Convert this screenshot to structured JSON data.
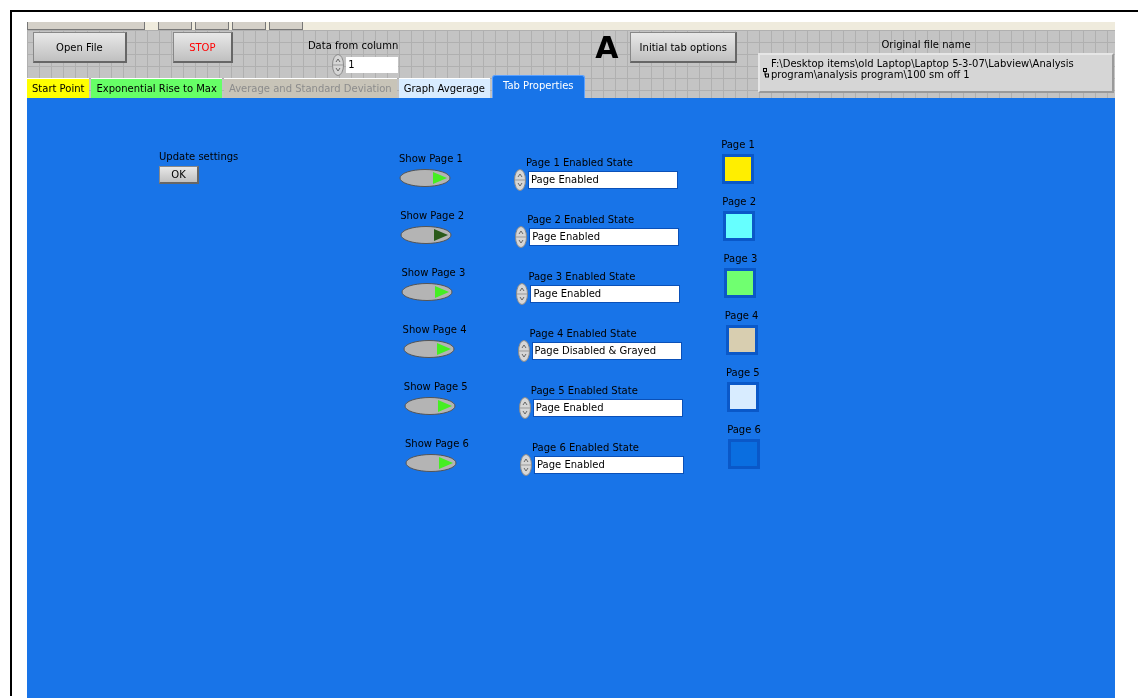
{
  "header": {
    "open_file_button": "Open File",
    "stop_button": "STOP",
    "data_from_column": {
      "label": "Data from column",
      "value": "1"
    },
    "marker": "A",
    "initial_tab_options_button": "Initial tab options",
    "original_file_name": {
      "label": "Original file name",
      "value": "F:\\Desktop items\\old Laptop\\Laptop 5-3-07\\Labview\\Analysis program\\analysis program\\100 sm off 1"
    }
  },
  "tabs": [
    {
      "label": "Start Point",
      "color": "#ffff00",
      "selected": false,
      "disabled": false
    },
    {
      "label": "Exponential Rise to Max",
      "color": "#66ff66",
      "selected": false,
      "disabled": false
    },
    {
      "label": "Average and Standard Deviation",
      "color": "#c8c4b8",
      "selected": false,
      "disabled": true
    },
    {
      "label": "Graph Avgerage",
      "color": "#d8ecff",
      "selected": false,
      "disabled": false
    },
    {
      "label": "Tab Properties",
      "color": "#1874e8",
      "selected": true,
      "disabled": false
    }
  ],
  "update_settings": {
    "label": "Update settings",
    "button": "OK"
  },
  "pages": [
    {
      "show_label": "Show Page 1",
      "shown": true,
      "state_label": "Page 1 Enabled State",
      "state_value": "Page Enabled",
      "color_label": "Page 1",
      "color": "#ffee00"
    },
    {
      "show_label": "Show Page 2",
      "shown": false,
      "state_label": "Page 2 Enabled State",
      "state_value": "Page Enabled",
      "color_label": "Page 2",
      "color": "#66ffff"
    },
    {
      "show_label": "Show Page 3",
      "shown": true,
      "state_label": "Page 3 Enabled State",
      "state_value": "Page Enabled",
      "color_label": "Page 3",
      "color": "#70ff70"
    },
    {
      "show_label": "Show Page 4",
      "shown": true,
      "state_label": "Page 4 Enabled State",
      "state_value": "Page Disabled & Grayed",
      "color_label": "Page 4",
      "color": "#d8ceb0"
    },
    {
      "show_label": "Show Page 5",
      "shown": true,
      "state_label": "Page 5 Enabled State",
      "state_value": "Page Enabled",
      "color_label": "Page 5",
      "color": "#d8ecff"
    },
    {
      "show_label": "Show Page 6",
      "shown": true,
      "state_label": "Page 6 Enabled State",
      "state_value": "Page Enabled",
      "color_label": "Page 6",
      "color": "#0a6ee0"
    }
  ]
}
